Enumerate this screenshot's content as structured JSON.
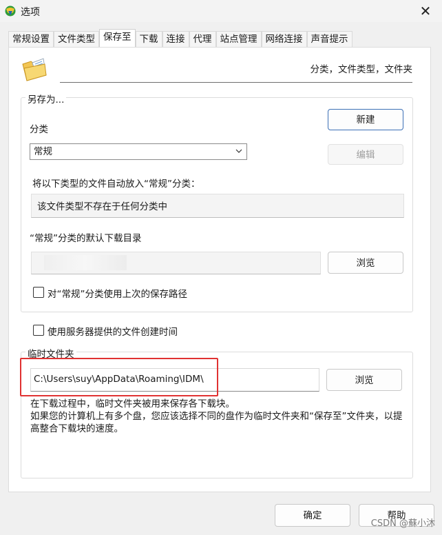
{
  "window": {
    "title": "选项",
    "close_glyph": "✕",
    "app_icon": "idm-globe-icon"
  },
  "tabs": [
    {
      "label": "常规设置",
      "active": false
    },
    {
      "label": "文件类型",
      "active": false
    },
    {
      "label": "保存至",
      "active": true
    },
    {
      "label": "下载",
      "active": false
    },
    {
      "label": "连接",
      "active": false
    },
    {
      "label": "代理",
      "active": false
    },
    {
      "label": "站点管理",
      "active": false
    },
    {
      "label": "网络连接",
      "active": false
    },
    {
      "label": "声音提示",
      "active": false
    }
  ],
  "header": {
    "text": "分类，文件类型，文件夹",
    "icon": "folder-icon"
  },
  "save_as": {
    "group_title": "另存为...",
    "category_label": "分类",
    "category_value": "常规",
    "new_button": "新建",
    "edit_button": "编辑",
    "auto_label": "将以下类型的文件自动放入“常规”分类：",
    "auto_value": "该文件类型不存在于任何分类中",
    "default_dir_label": "“常规”分类的默认下载目录",
    "default_dir_value": "",
    "browse_button": "浏览",
    "use_last_path_label": "对“常规”分类使用上次的保存路径",
    "use_last_path_checked": false
  },
  "server_time": {
    "label": "使用服务器提供的文件创建时间",
    "checked": false
  },
  "temp_folder": {
    "group_title": "临时文件夹",
    "path": "C:\\Users\\suy\\AppData\\Roaming\\IDM\\",
    "browse_button": "浏览",
    "description": "在下载过程中，临时文件夹被用来保存各下载块。\n如果您的计算机上有多个盘，您应该选择不同的盘作为临时文件夹和“保存至”文件夹，以提高整合下载块的速度。"
  },
  "footer": {
    "ok_button": "确定",
    "help_button": "帮助"
  },
  "watermark": "CSDN @蘇小沐",
  "colors": {
    "highlight_box": "#e03131",
    "primary_border": "#3b6fb6"
  }
}
